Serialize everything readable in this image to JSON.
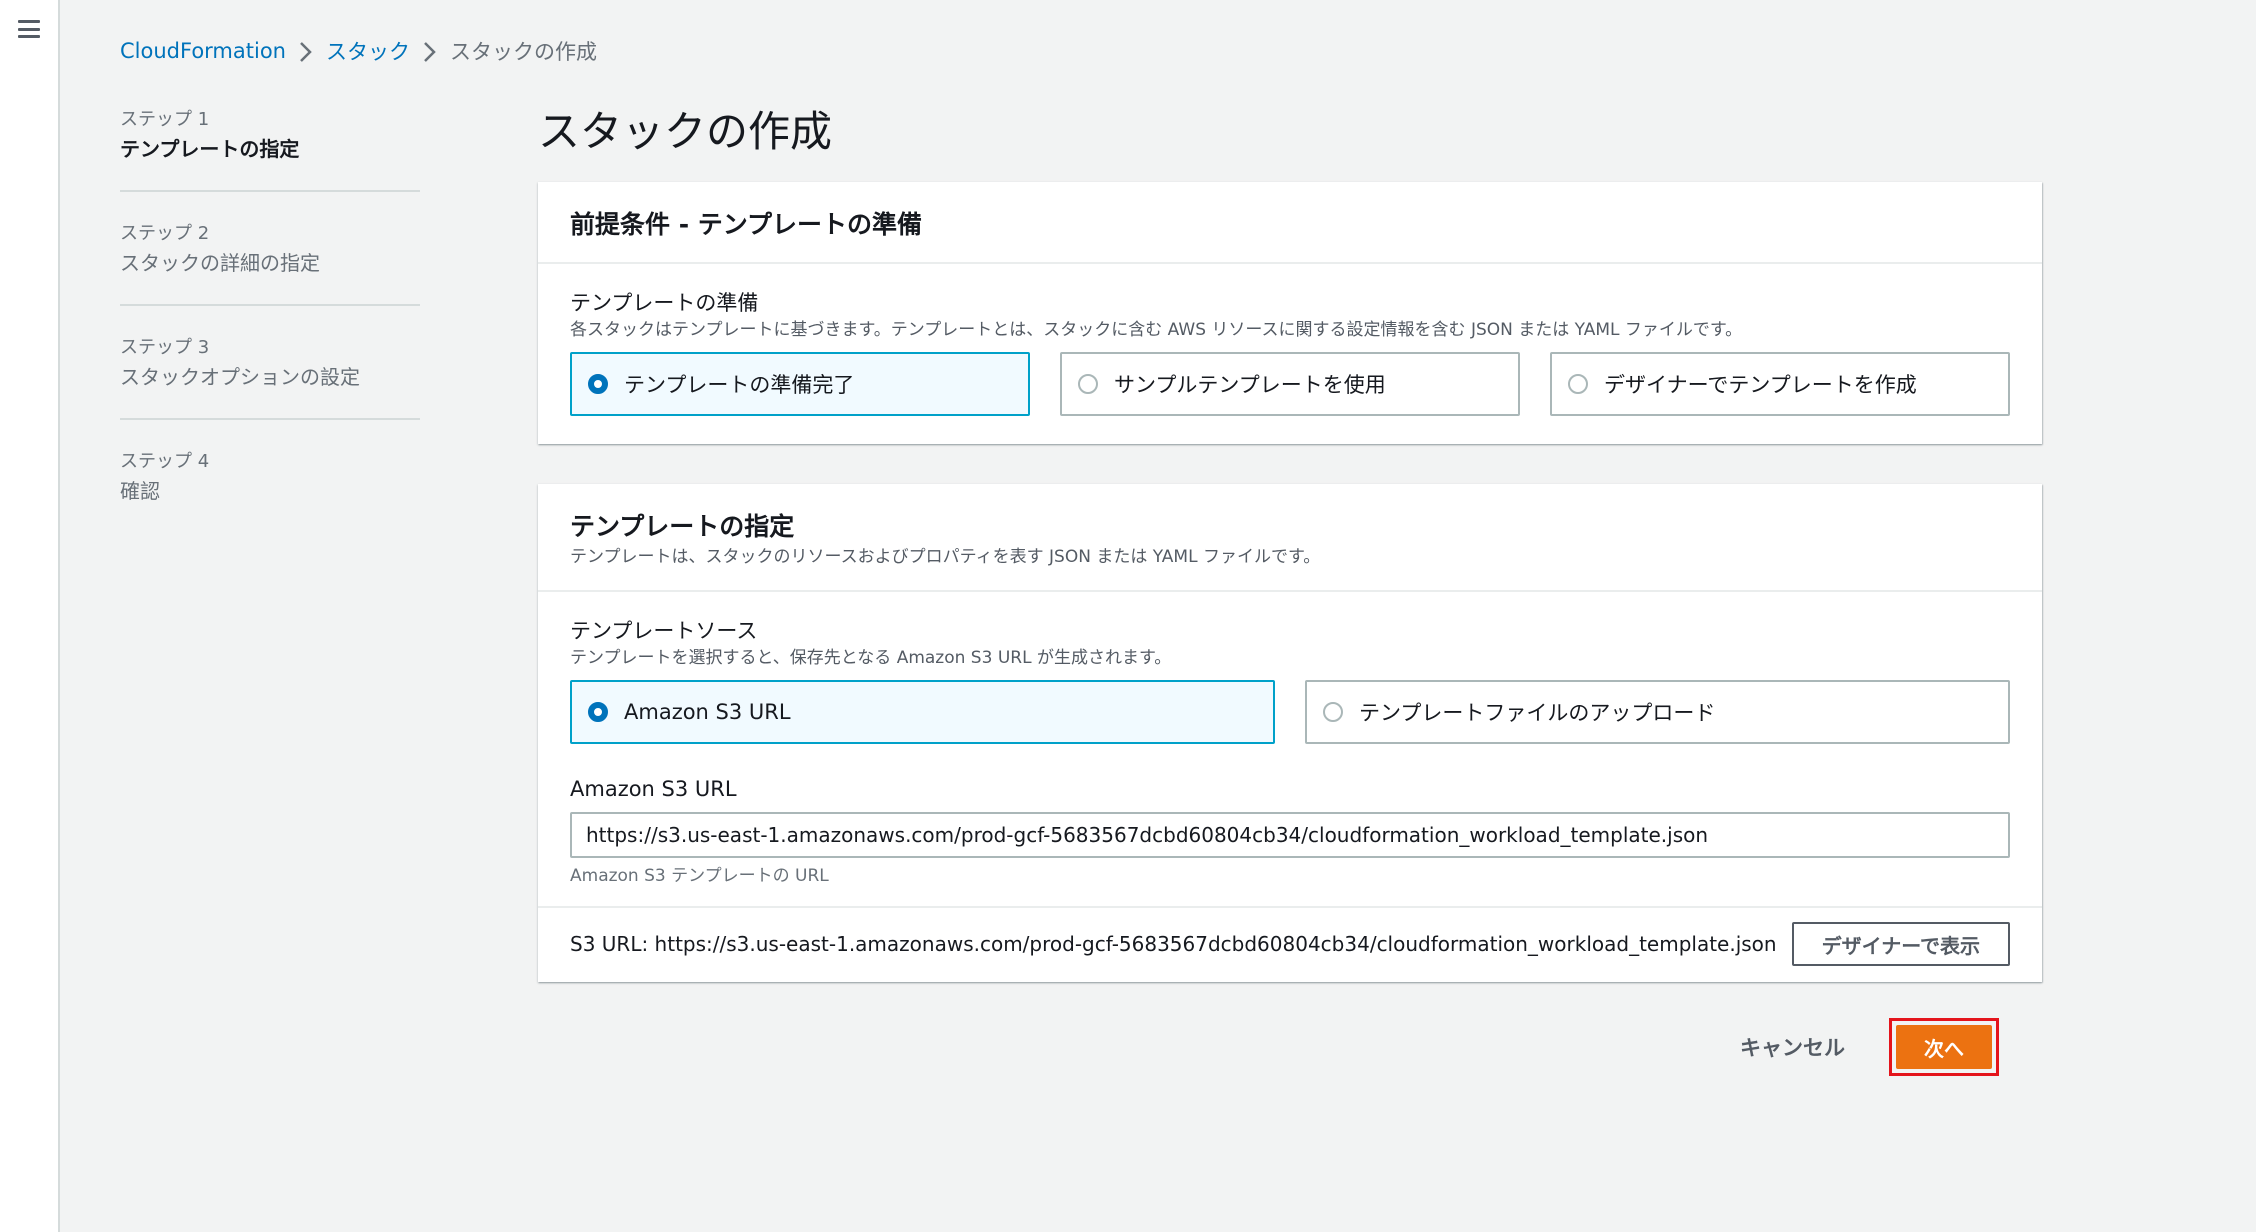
{
  "breadcrumb": {
    "items": [
      "CloudFormation",
      "スタック"
    ],
    "current": "スタックの作成"
  },
  "steps": [
    {
      "num": "ステップ 1",
      "title": "テンプレートの指定"
    },
    {
      "num": "ステップ 2",
      "title": "スタックの詳細の指定"
    },
    {
      "num": "ステップ 3",
      "title": "スタックオプションの設定"
    },
    {
      "num": "ステップ 4",
      "title": "確認"
    }
  ],
  "page_title": "スタックの作成",
  "prereq": {
    "title": "前提条件 - テンプレートの準備",
    "label": "テンプレートの準備",
    "desc": "各スタックはテンプレートに基づきます。テンプレートとは、スタックに含む AWS リソースに関する設定情報を含む JSON または YAML ファイルです。",
    "options": [
      "テンプレートの準備完了",
      "サンプルテンプレートを使用",
      "デザイナーでテンプレートを作成"
    ],
    "selected": "テンプレートの準備完了"
  },
  "spec": {
    "title": "テンプレートの指定",
    "desc": "テンプレートは、スタックのリソースおよびプロパティを表す JSON または YAML ファイルです。",
    "source_label": "テンプレートソース",
    "source_desc": "テンプレートを選択すると、保存先となる Amazon S3 URL が生成されます。",
    "options": [
      "Amazon S3 URL",
      "テンプレートファイルのアップロード"
    ],
    "selected": "Amazon S3 URL",
    "url_label": "Amazon S3 URL",
    "url_value": "https://s3.us-east-1.amazonaws.com/prod-gcf-5683567dcbd60804cb34/cloudformation_workload_template.json",
    "url_constraint": "Amazon S3 テンプレートの URL",
    "footer_text": "S3 URL:  https://s3.us-east-1.amazonaws.com/prod-gcf-5683567dcbd60804cb34/cloudformation_workload_template.json",
    "designer_button": "デザイナーで表示"
  },
  "actions": {
    "cancel": "キャンセル",
    "next": "次へ"
  },
  "colors": {
    "link": "#0073bb",
    "selected_border": "#00a1c9",
    "primary_button": "#ec7211",
    "highlight": "#e4141b"
  }
}
